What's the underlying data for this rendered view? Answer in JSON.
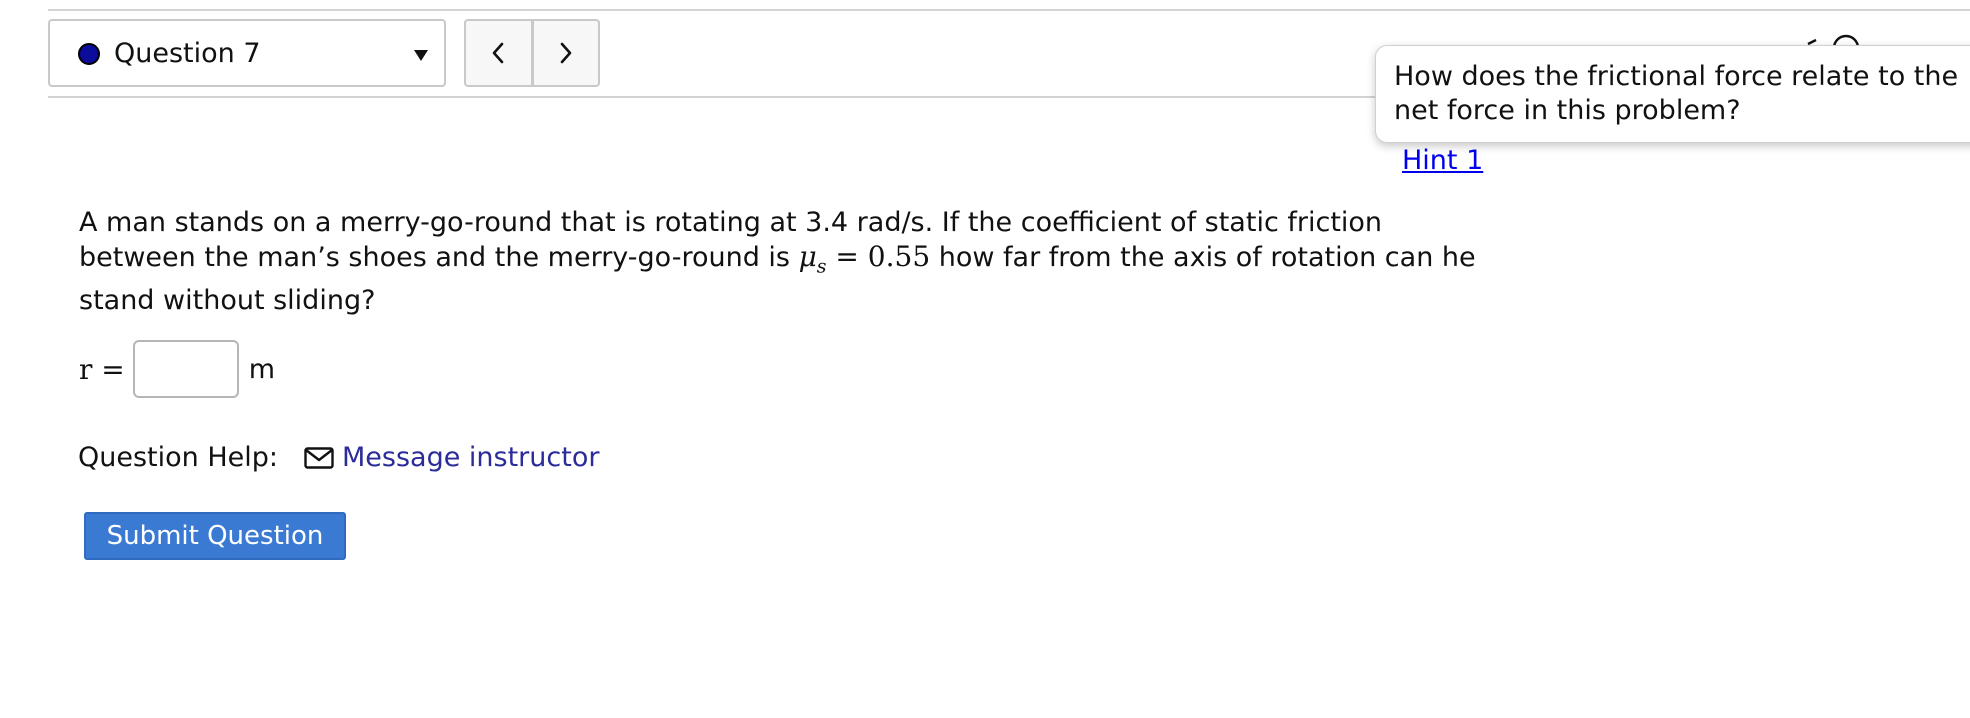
{
  "question_nav": {
    "selected_label": "Question 7",
    "status_color": "#0b0b9c",
    "prev_icon": "chevron-left-icon",
    "next_icon": "chevron-right-icon"
  },
  "hint": {
    "popover_text": "How does the frictional force relate to the net force in this problem?",
    "link_label": "Hint 1"
  },
  "question": {
    "text_before_math": "A man stands on a merry-go-round that is rotating at 3.4 rad/s. If the coefficient of static friction between the man’s shoes and the merry-go-round is ",
    "math_symbol": "μ",
    "math_subscript": "s",
    "math_rest": " = 0.55",
    "text_after_math": " how far from the axis of rotation can he stand without sliding?"
  },
  "answer": {
    "variable": "r =",
    "value": "",
    "unit": "m"
  },
  "help": {
    "label": "Question Help:",
    "message_icon": "mail-icon",
    "message_label": "Message instructor"
  },
  "submit": {
    "label": "Submit Question",
    "color": "#3a7ad3"
  }
}
